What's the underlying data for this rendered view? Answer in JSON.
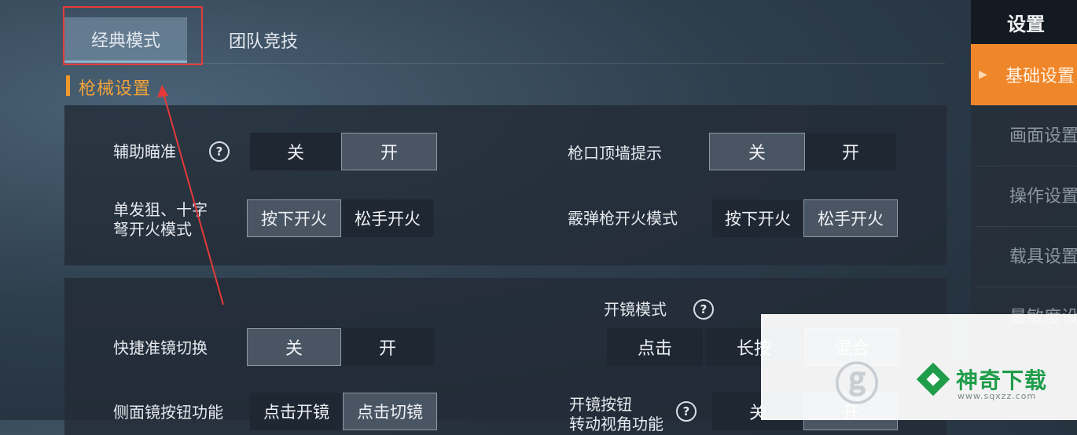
{
  "tabs": [
    {
      "label": "经典模式",
      "selected": true
    },
    {
      "label": "团队竞技",
      "selected": false
    }
  ],
  "section_title": "枪械设置",
  "sidebar": {
    "title": "设置",
    "items": [
      {
        "label": "基础设置",
        "active": true
      },
      {
        "label": "画面设置",
        "active": false
      },
      {
        "label": "操作设置",
        "active": false
      },
      {
        "label": "载具设置",
        "active": false
      },
      {
        "label": "最敏度设置",
        "active": false
      }
    ]
  },
  "settings": {
    "aim_assist": {
      "label": "辅助瞄准",
      "help": "?",
      "options": [
        "关",
        "开"
      ],
      "selected": "开"
    },
    "muzzle_hint": {
      "label": "枪口顶墙提示",
      "options": [
        "关",
        "开"
      ],
      "selected": "关"
    },
    "sniper_fire": {
      "label_line1": "单发狙、十字",
      "label_line2": "弩开火模式",
      "options": [
        "按下开火",
        "松手开火"
      ],
      "selected": "按下开火"
    },
    "shotgun_fire": {
      "label": "霰弹枪开火模式",
      "options": [
        "按下开火",
        "松手开火"
      ],
      "selected": "松手开火"
    },
    "scope_mode": {
      "label": "开镜模式",
      "help": "?",
      "options": [
        "点击",
        "长按",
        "混合"
      ],
      "selected": "混合"
    },
    "quick_scope": {
      "label": "快捷准镜切换",
      "options": [
        "关",
        "开"
      ],
      "selected": "关"
    },
    "side_scope": {
      "label": "侧面镜按钮功能",
      "options": [
        "点击开镜",
        "点击切镜"
      ],
      "selected": "点击切镜"
    },
    "scope_button": {
      "label_line1": "开镜按钮",
      "label_line2": "转动视角功能",
      "help": "?",
      "options": [
        "关",
        "开"
      ],
      "selected": "关"
    }
  },
  "watermark": {
    "name": "神奇下载",
    "url": "www.sqxzz.com"
  },
  "colors": {
    "accent_orange": "#f0862a",
    "section_orange": "#f2a33a",
    "annotation_red": "#e53a3a",
    "brand_green": "#1f9d4a"
  }
}
